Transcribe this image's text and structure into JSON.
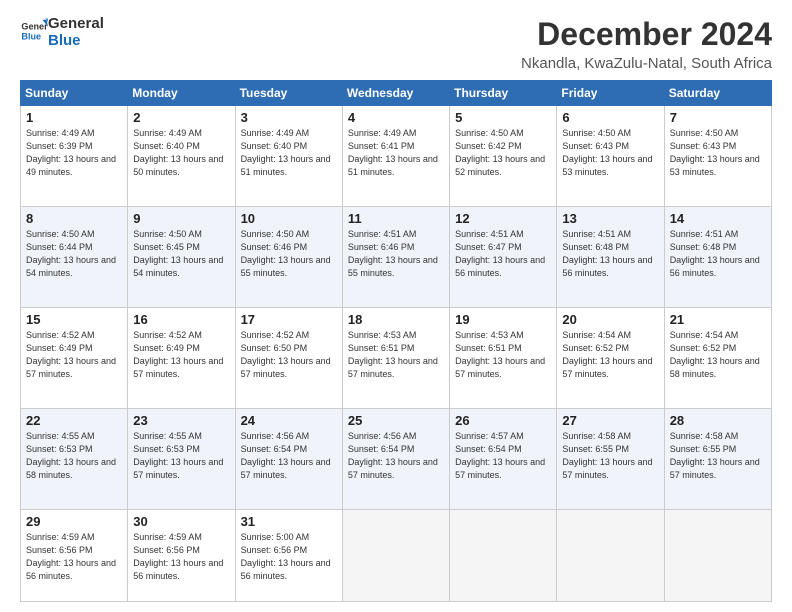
{
  "header": {
    "logo_general": "General",
    "logo_blue": "Blue",
    "month_title": "December 2024",
    "location": "Nkandla, KwaZulu-Natal, South Africa"
  },
  "days_of_week": [
    "Sunday",
    "Monday",
    "Tuesday",
    "Wednesday",
    "Thursday",
    "Friday",
    "Saturday"
  ],
  "weeks": [
    [
      {
        "day": "1",
        "sunrise": "4:49 AM",
        "sunset": "6:39 PM",
        "daylight": "13 hours and 49 minutes."
      },
      {
        "day": "2",
        "sunrise": "4:49 AM",
        "sunset": "6:40 PM",
        "daylight": "13 hours and 50 minutes."
      },
      {
        "day": "3",
        "sunrise": "4:49 AM",
        "sunset": "6:40 PM",
        "daylight": "13 hours and 51 minutes."
      },
      {
        "day": "4",
        "sunrise": "4:49 AM",
        "sunset": "6:41 PM",
        "daylight": "13 hours and 51 minutes."
      },
      {
        "day": "5",
        "sunrise": "4:50 AM",
        "sunset": "6:42 PM",
        "daylight": "13 hours and 52 minutes."
      },
      {
        "day": "6",
        "sunrise": "4:50 AM",
        "sunset": "6:43 PM",
        "daylight": "13 hours and 53 minutes."
      },
      {
        "day": "7",
        "sunrise": "4:50 AM",
        "sunset": "6:43 PM",
        "daylight": "13 hours and 53 minutes."
      }
    ],
    [
      {
        "day": "8",
        "sunrise": "4:50 AM",
        "sunset": "6:44 PM",
        "daylight": "13 hours and 54 minutes."
      },
      {
        "day": "9",
        "sunrise": "4:50 AM",
        "sunset": "6:45 PM",
        "daylight": "13 hours and 54 minutes."
      },
      {
        "day": "10",
        "sunrise": "4:50 AM",
        "sunset": "6:46 PM",
        "daylight": "13 hours and 55 minutes."
      },
      {
        "day": "11",
        "sunrise": "4:51 AM",
        "sunset": "6:46 PM",
        "daylight": "13 hours and 55 minutes."
      },
      {
        "day": "12",
        "sunrise": "4:51 AM",
        "sunset": "6:47 PM",
        "daylight": "13 hours and 56 minutes."
      },
      {
        "day": "13",
        "sunrise": "4:51 AM",
        "sunset": "6:48 PM",
        "daylight": "13 hours and 56 minutes."
      },
      {
        "day": "14",
        "sunrise": "4:51 AM",
        "sunset": "6:48 PM",
        "daylight": "13 hours and 56 minutes."
      }
    ],
    [
      {
        "day": "15",
        "sunrise": "4:52 AM",
        "sunset": "6:49 PM",
        "daylight": "13 hours and 57 minutes."
      },
      {
        "day": "16",
        "sunrise": "4:52 AM",
        "sunset": "6:49 PM",
        "daylight": "13 hours and 57 minutes."
      },
      {
        "day": "17",
        "sunrise": "4:52 AM",
        "sunset": "6:50 PM",
        "daylight": "13 hours and 57 minutes."
      },
      {
        "day": "18",
        "sunrise": "4:53 AM",
        "sunset": "6:51 PM",
        "daylight": "13 hours and 57 minutes."
      },
      {
        "day": "19",
        "sunrise": "4:53 AM",
        "sunset": "6:51 PM",
        "daylight": "13 hours and 57 minutes."
      },
      {
        "day": "20",
        "sunrise": "4:54 AM",
        "sunset": "6:52 PM",
        "daylight": "13 hours and 57 minutes."
      },
      {
        "day": "21",
        "sunrise": "4:54 AM",
        "sunset": "6:52 PM",
        "daylight": "13 hours and 58 minutes."
      }
    ],
    [
      {
        "day": "22",
        "sunrise": "4:55 AM",
        "sunset": "6:53 PM",
        "daylight": "13 hours and 58 minutes."
      },
      {
        "day": "23",
        "sunrise": "4:55 AM",
        "sunset": "6:53 PM",
        "daylight": "13 hours and 57 minutes."
      },
      {
        "day": "24",
        "sunrise": "4:56 AM",
        "sunset": "6:54 PM",
        "daylight": "13 hours and 57 minutes."
      },
      {
        "day": "25",
        "sunrise": "4:56 AM",
        "sunset": "6:54 PM",
        "daylight": "13 hours and 57 minutes."
      },
      {
        "day": "26",
        "sunrise": "4:57 AM",
        "sunset": "6:54 PM",
        "daylight": "13 hours and 57 minutes."
      },
      {
        "day": "27",
        "sunrise": "4:58 AM",
        "sunset": "6:55 PM",
        "daylight": "13 hours and 57 minutes."
      },
      {
        "day": "28",
        "sunrise": "4:58 AM",
        "sunset": "6:55 PM",
        "daylight": "13 hours and 57 minutes."
      }
    ],
    [
      {
        "day": "29",
        "sunrise": "4:59 AM",
        "sunset": "6:56 PM",
        "daylight": "13 hours and 56 minutes."
      },
      {
        "day": "30",
        "sunrise": "4:59 AM",
        "sunset": "6:56 PM",
        "daylight": "13 hours and 56 minutes."
      },
      {
        "day": "31",
        "sunrise": "5:00 AM",
        "sunset": "6:56 PM",
        "daylight": "13 hours and 56 minutes."
      },
      null,
      null,
      null,
      null
    ]
  ]
}
